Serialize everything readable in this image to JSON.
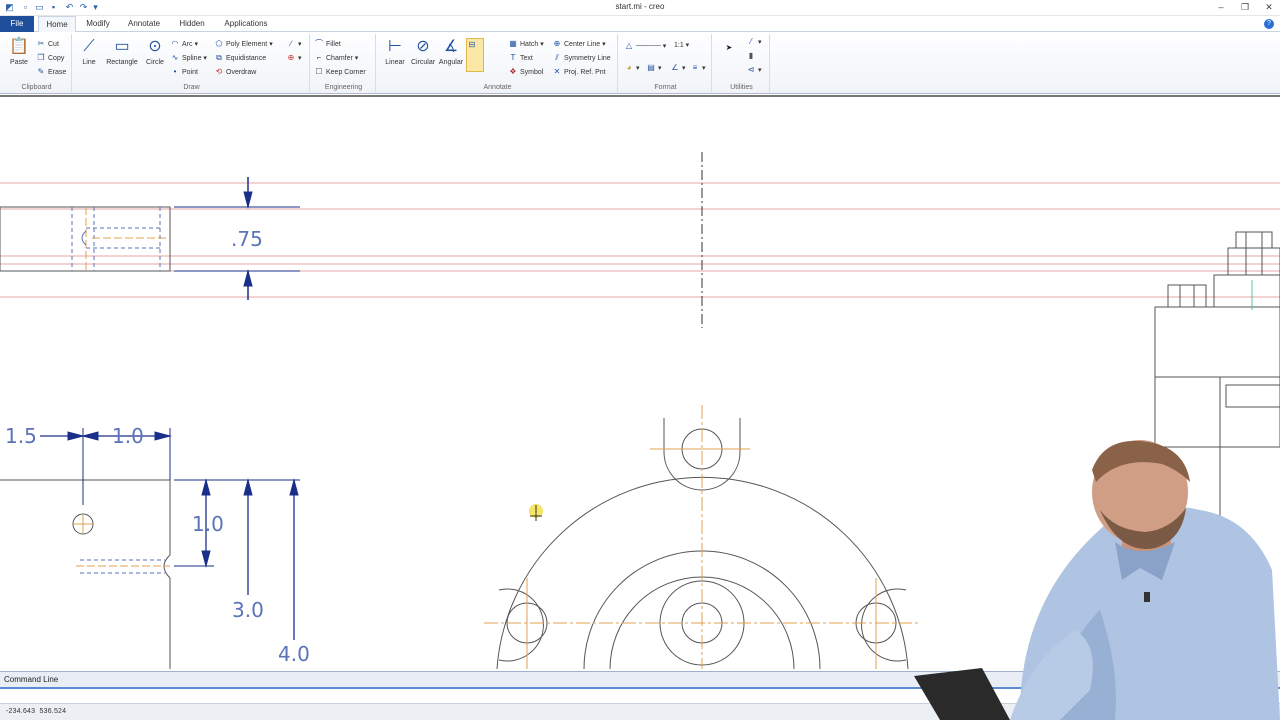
{
  "window": {
    "title": "start.mi - creo"
  },
  "tabs": [
    {
      "label": "File"
    },
    {
      "label": "Home"
    },
    {
      "label": "Modify"
    },
    {
      "label": "Annotate"
    },
    {
      "label": "Hidden"
    },
    {
      "label": "Applications"
    }
  ],
  "ribbon": {
    "clipboard": {
      "group_label": "Clipboard",
      "paste": "Paste",
      "cut": "Cut",
      "copy": "Copy",
      "erase": "Erase"
    },
    "draw": {
      "group_label": "Draw",
      "line": "Line",
      "rectangle": "Rectangle",
      "circle": "Circle",
      "arc": "Arc",
      "spline": "Spline",
      "point": "Point",
      "poly_element": "Poly Element",
      "equidistance": "Equidistance",
      "overdraw": "Overdraw"
    },
    "engineering": {
      "group_label": "Engineering",
      "fillet": "Fillet",
      "chamfer": "Chamfer",
      "keep_corner": "Keep Corner"
    },
    "annotate": {
      "group_label": "Annotate",
      "linear": "Linear",
      "circular": "Circular",
      "angular": "Angular",
      "hatch": "Hatch",
      "text": "Text",
      "symbol": "Symbol",
      "center_line": "Center Line",
      "symmetry_line": "Symmetry Line",
      "proj_ref_pnt": "Proj. Ref. Pnt"
    },
    "format": {
      "group_label": "Format",
      "scale": "1:1"
    },
    "utilities": {
      "group_label": "Utilities"
    }
  },
  "drawing": {
    "dimensions": {
      "d075": ".75",
      "d15": "1.5",
      "d10_horizontal": "1.0",
      "d10_vertical": "1.0",
      "d30": "3.0",
      "d40": "4.0"
    }
  },
  "command_line": {
    "label": "Command Line"
  },
  "status": {
    "coord_x": "-234.643",
    "coord_y": "536.524"
  },
  "colors": {
    "ribbon_blue": "#1f4f9a",
    "dimension_blue": "#5b73b8",
    "dimension_arrow": "#1a2f8a",
    "construction_red": "#e0a0a0",
    "centerline_orange": "#e0a050",
    "geometry": "#555555"
  },
  "icons": {
    "paste": "clipboard-icon",
    "cut": "scissors-icon",
    "copy": "copy-icon",
    "erase": "eraser-icon",
    "line": "line-icon",
    "rectangle": "rectangle-icon",
    "circle": "circle-icon",
    "cursor": "arrow-cursor-icon"
  }
}
